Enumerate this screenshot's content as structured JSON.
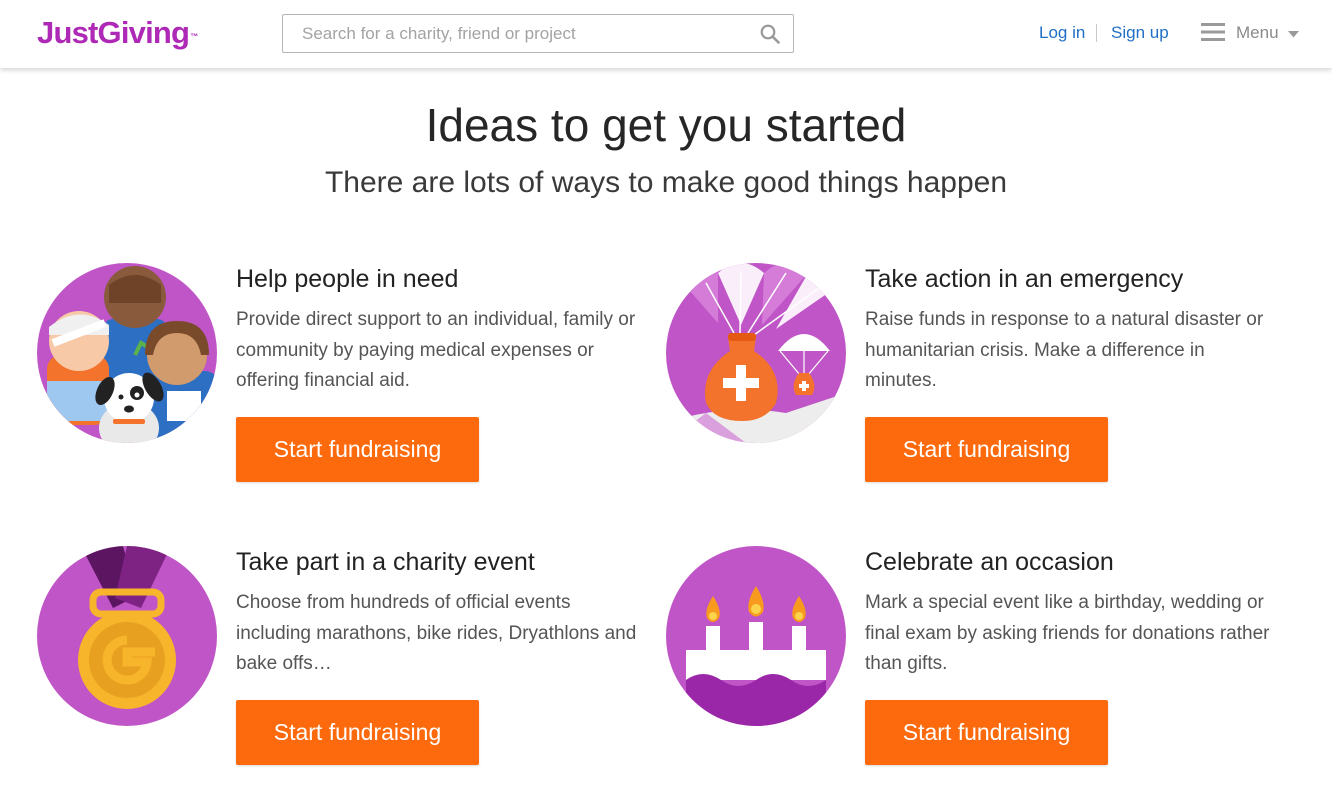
{
  "header": {
    "logo_text": "JustGiving",
    "logo_tm": "™",
    "search": {
      "placeholder": "Search for a charity, friend or project",
      "value": ""
    },
    "login_label": "Log in",
    "signup_label": "Sign up",
    "menu_label": "Menu"
  },
  "hero": {
    "title": "Ideas to get you started",
    "subtitle": "There are lots of ways to make good things happen"
  },
  "cards": [
    {
      "title": "Help people in need",
      "description": "Provide direct support to an individual, family or community by paying medical expenses or offering financial aid.",
      "button_label": "Start fundraising",
      "icon": "people-group-icon"
    },
    {
      "title": "Take action in an emergency",
      "description": "Raise funds in response to a natural disaster or humanitarian crisis. Make a difference in minutes.",
      "button_label": "Start fundraising",
      "icon": "parachute-aid-icon"
    },
    {
      "title": "Take part in a charity event",
      "description": "Choose from hundreds of official events including marathons, bike rides, Dryathlons and bake offs…",
      "button_label": "Start fundraising",
      "icon": "medal-icon"
    },
    {
      "title": "Celebrate an occasion",
      "description": "Mark a special event like a birthday, wedding or final exam by asking friends for donations rather than gifts.",
      "button_label": "Start fundraising",
      "icon": "birthday-cake-icon"
    }
  ],
  "colors": {
    "brand": "#ad29b6",
    "cta": "#fd6a0d",
    "link": "#1f6fc6",
    "illustration_bg": "#bf55c6"
  }
}
